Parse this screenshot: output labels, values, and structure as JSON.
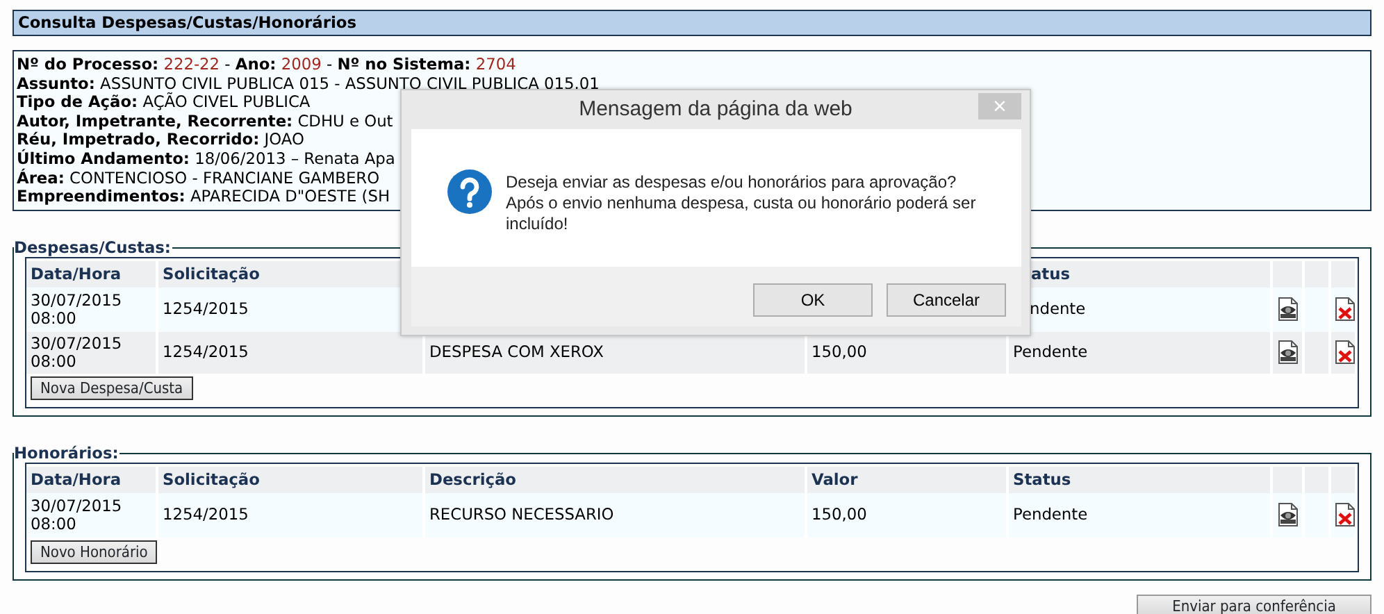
{
  "page_title": "Consulta Despesas/Custas/Honorários",
  "info": [
    {
      "kind": "process",
      "parts": [
        {
          "label": "Nº do Processo:",
          "value": "222-22"
        },
        {
          "label": "Ano:",
          "value": "2009"
        },
        {
          "label": "Nº no Sistema:",
          "value": "2704"
        }
      ],
      "separator": "-"
    },
    {
      "kind": "field",
      "label": "Assunto:",
      "value": "ASSUNTO CIVIL PUBLICA 015 - ASSUNTO CIVIL PUBLICA 015.01"
    },
    {
      "kind": "field",
      "label": "Tipo de Ação:",
      "value": "AÇÃO CIVEL PUBLICA"
    },
    {
      "kind": "field",
      "label": "Autor, Impetrante, Recorrente:",
      "value": "CDHU e Out"
    },
    {
      "kind": "field",
      "label": "Réu, Impetrado, Recorrido:",
      "value": "JOAO"
    },
    {
      "kind": "field",
      "label": "Último Andamento:",
      "value": "18/06/2013 – Renata Apa"
    },
    {
      "kind": "field",
      "label": "Área:",
      "value": "CONTENCIOSO - FRANCIANE GAMBERO"
    },
    {
      "kind": "field",
      "label": "Empreendimentos:",
      "value": "APARECIDA D\"OESTE (SH"
    }
  ],
  "sections": [
    {
      "title": "Despesas/Custas:",
      "header": {
        "date": "Data/Hora",
        "request": "Solicitação",
        "status": "atus"
      },
      "rows": [
        {
          "date": "30/07/2015 08:00",
          "request": "1254/2015",
          "status": "ndente"
        },
        {
          "date": "30/07/2015 08:00",
          "request": "1254/2015",
          "description": "DESPESA COM XEROX",
          "value": "150,00",
          "status": "Pendente"
        }
      ],
      "button": "Nova Despesa/Custa"
    },
    {
      "title": "Honorários:",
      "header": {
        "date": "Data/Hora",
        "request": "Solicitação",
        "description": "Descrição",
        "value": "Valor",
        "status": "Status"
      },
      "rows": [
        {
          "date": "30/07/2015 08:00",
          "request": "1254/2015",
          "description": "RECURSO NECESSARIO",
          "value": "150,00",
          "status": "Pendente"
        }
      ],
      "button": "Novo Honorário"
    }
  ],
  "submit_button": "Enviar para conferência",
  "dialog": {
    "title": "Mensagem da página da web",
    "close": "×",
    "message": "Deseja enviar as despesas e/ou honorários para aprovação? Após o envio nenhuma despesa, custa ou honorário poderá ser incluído!",
    "buttons": [
      "OK",
      "Cancelar"
    ]
  }
}
